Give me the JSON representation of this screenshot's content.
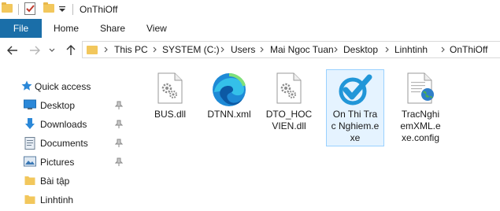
{
  "window": {
    "title": "OnThiOff"
  },
  "ribbon": {
    "tabs": [
      "File",
      "Home",
      "Share",
      "View"
    ]
  },
  "address": {
    "crumbs": [
      "This PC",
      "SYSTEM (C:)",
      "Users",
      "Mai Ngoc Tuan",
      "Desktop",
      "Linhtinh",
      "OnThiOff"
    ]
  },
  "sidebar": {
    "items": [
      {
        "label": "Quick access",
        "icon": "star-icon",
        "pinned": false
      },
      {
        "label": "Desktop",
        "icon": "desktop-icon",
        "pinned": true
      },
      {
        "label": "Downloads",
        "icon": "download-arrow-icon",
        "pinned": true
      },
      {
        "label": "Documents",
        "icon": "documents-icon",
        "pinned": true
      },
      {
        "label": "Pictures",
        "icon": "pictures-icon",
        "pinned": true
      },
      {
        "label": "Bài tập",
        "icon": "folder-icon",
        "pinned": false
      },
      {
        "label": "Linhtinh",
        "icon": "folder-icon",
        "pinned": false
      }
    ]
  },
  "files": [
    {
      "name": "BUS.dll",
      "icon": "dll-gear-icon",
      "selected": false
    },
    {
      "name": "DTNN.xml",
      "icon": "edge-xml-icon",
      "selected": false
    },
    {
      "name": "DTO_HOCVIEN.dll",
      "icon": "dll-gear-icon",
      "selected": false
    },
    {
      "name": "On Thi Trac Nghiem.exe",
      "icon": "checkmark-app-icon",
      "selected": true
    },
    {
      "name": "TracNghiemXML.exe.config",
      "icon": "config-globe-icon",
      "selected": false
    }
  ],
  "colors": {
    "accent": "#1a6ea8",
    "selection": "#e5f3ff",
    "folder": "#f2c75c"
  }
}
